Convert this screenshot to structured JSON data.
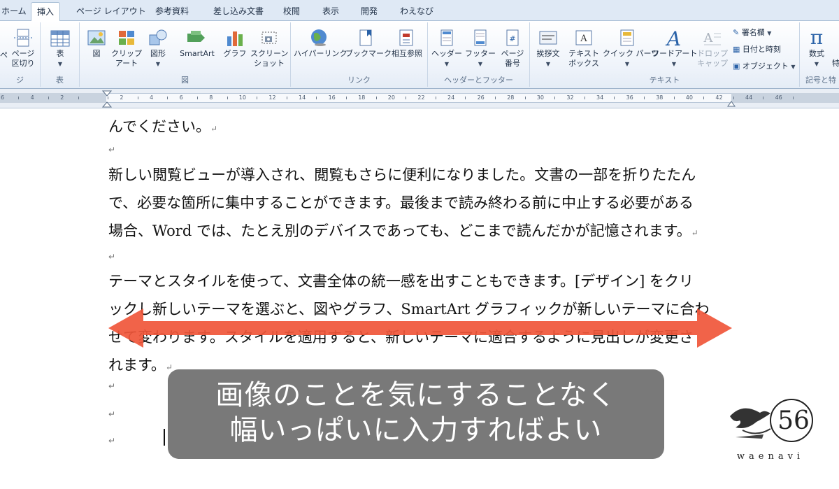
{
  "tabs": [
    "ホーム",
    "挿入",
    "ページ レイアウト",
    "参考資料",
    "差し込み文書",
    "校閲",
    "表示",
    "開発",
    "わえなび"
  ],
  "ribbon": {
    "groups": {
      "page": {
        "label": "ジ",
        "btn": "ページ\n区切り",
        "left": "ぺ"
      },
      "table": {
        "label": "表",
        "btn": "表"
      },
      "illust": {
        "label": "図",
        "picture": "図",
        "clipart": "クリップ\nアート",
        "shapes": "図形",
        "smartart": "SmartArt",
        "chart": "グラフ",
        "screenshot": "スクリーン\nショット"
      },
      "link": {
        "label": "リンク",
        "hyperlink": "ハイパーリンク",
        "bookmark": "ブックマーク",
        "xref": "相互参照"
      },
      "hf": {
        "label": "ヘッダーとフッター",
        "header": "ヘッダー",
        "footer": "フッター",
        "pagenum": "ページ\n番号"
      },
      "text": {
        "label": "テキスト",
        "greeting": "挨拶文",
        "textbox": "テキスト\nボックス",
        "quickparts": "クイック パーツ",
        "wordart": "ワードアート",
        "dropcap": "ドロップ\nキャップ",
        "signature": "署名欄",
        "datetime": "日付と時刻",
        "object": "オブジェクト"
      },
      "symbols": {
        "label": "記号と特",
        "equation": "数式",
        "symbol": "特"
      }
    }
  },
  "ruler": {
    "numbers": [
      "6",
      "4",
      "2",
      "",
      "2",
      "4",
      "6",
      "8",
      "10",
      "12",
      "14",
      "16",
      "18",
      "20",
      "22",
      "24",
      "26",
      "28",
      "30",
      "32",
      "34",
      "36",
      "38",
      "40",
      "42",
      "44",
      "46"
    ]
  },
  "document": {
    "line0": "んでください。",
    "p1": [
      "新しい閲覧ビューが導入され、閲覧もさらに便利になりました。文書の一部を折りたたん",
      "で、必要な箇所に集中することができます。最後まで読み終わる前に中止する必要がある",
      "場合、Word では、たとえ別のデバイスであっても、どこまで読んだかが記憶されます。"
    ],
    "p2": [
      "テーマとスタイルを使って、文書全体の統一感を出すこともできます。[デザイン] をクリ",
      "ックし新しいテーマを選ぶと、図やグラフ、SmartArt グラフィックが新しいテーマに合わ",
      "せて変わります。スタイルを適用すると、新しいテーマに適合するように見出しが変更さ",
      "れます。"
    ],
    "paragraph_mark": "↵"
  },
  "caption": {
    "line1": "画像のことを気にすることなく",
    "line2": "幅いっぱいに入力すればよい"
  },
  "logo": {
    "text": "waenavi",
    "mark": "56"
  },
  "colors": {
    "arrow": "#f0563a",
    "accent": "#2a62a8"
  }
}
